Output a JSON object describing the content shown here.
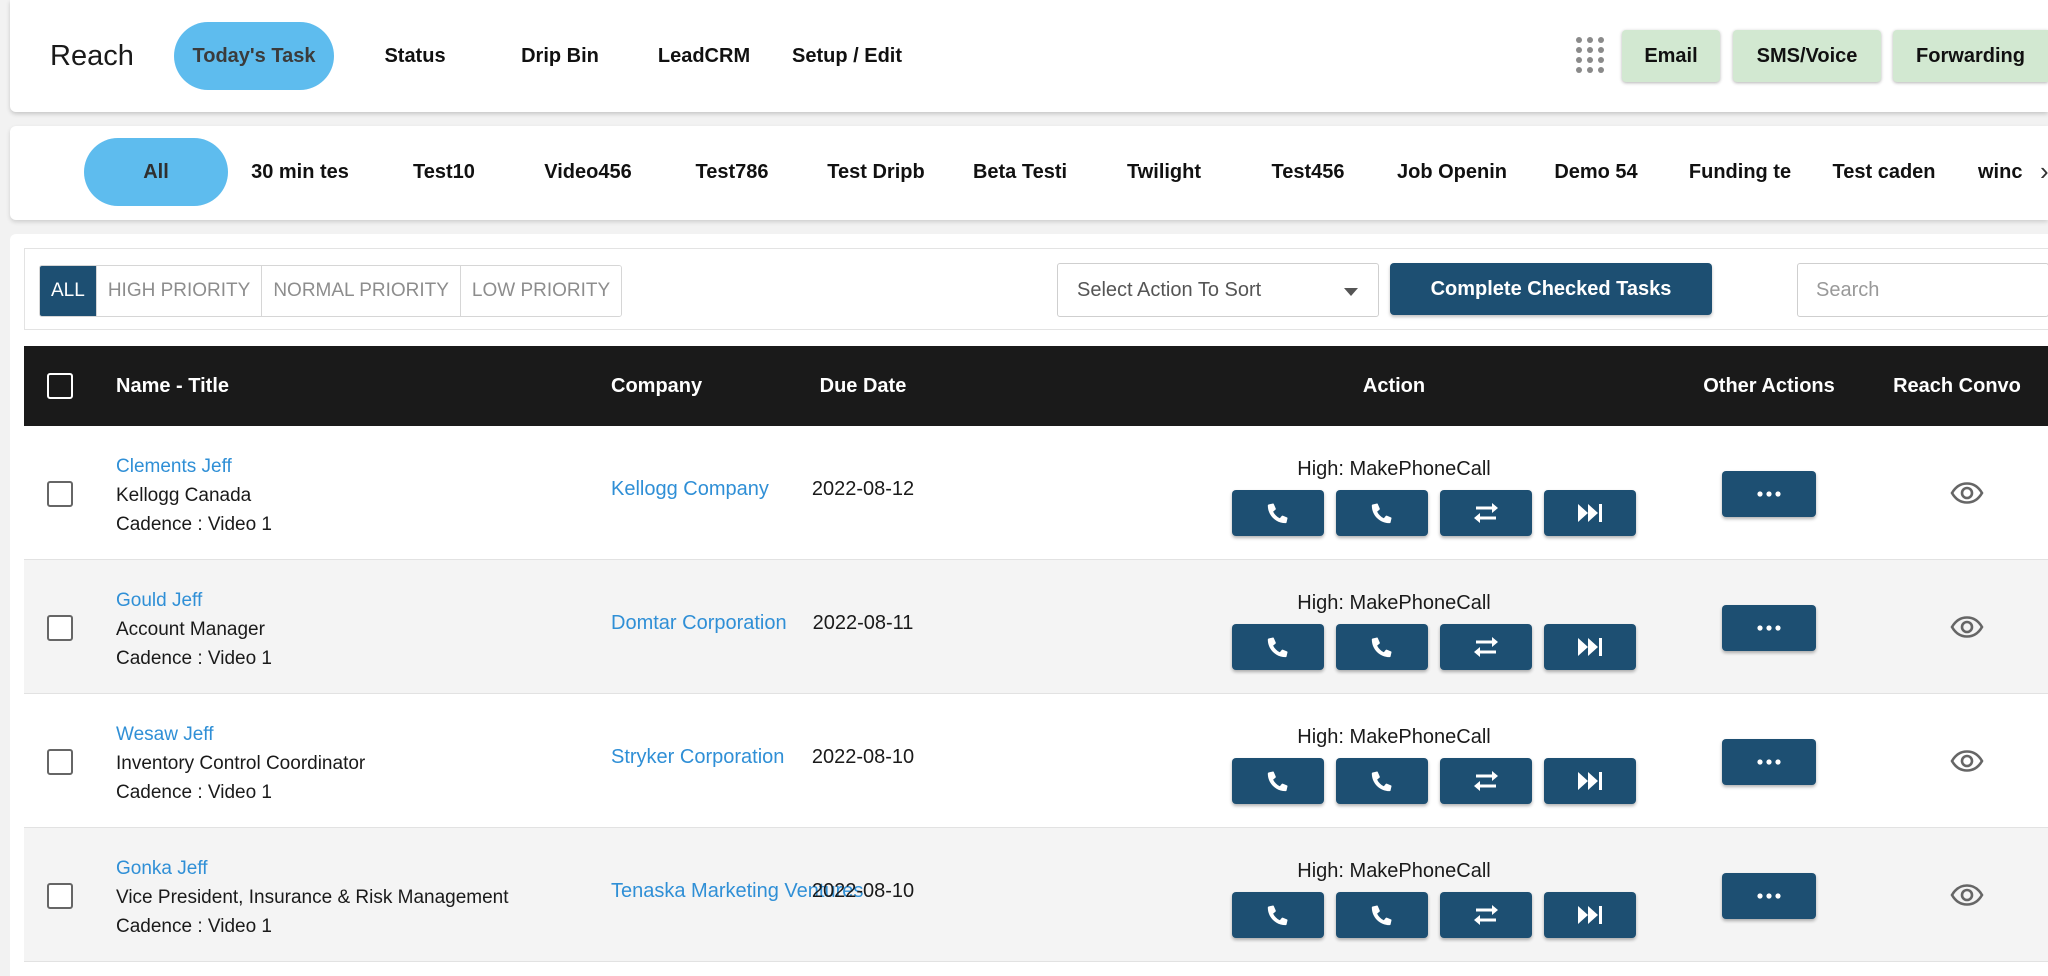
{
  "app": {
    "brand": "Reach"
  },
  "nav": {
    "items": [
      {
        "label": "Today's Task",
        "active": true
      },
      {
        "label": "Status"
      },
      {
        "label": "Drip Bin"
      },
      {
        "label": "LeadCRM"
      },
      {
        "label": "Setup / Edit"
      }
    ],
    "modes": [
      "Email",
      "SMS/Voice",
      "Forwarding"
    ]
  },
  "cadences": {
    "items": [
      "All",
      "30 min tes",
      "Test10",
      "Video456",
      "Test786",
      "Test Dripb",
      "Beta Testi",
      "Twilight",
      "Test456",
      "Job Openin",
      "Demo 54",
      "Funding te",
      "Test caden",
      "winc"
    ],
    "more_glyph": "›"
  },
  "toolbar": {
    "priorities": [
      "ALL",
      "HIGH PRIORITY",
      "NORMAL PRIORITY",
      "LOW PRIORITY"
    ],
    "sort_label": "Select Action To Sort",
    "complete_label": "Complete Checked Tasks",
    "search_placeholder": "Search"
  },
  "table": {
    "columns": {
      "name": "Name - Title",
      "company": "Company",
      "due": "Due Date",
      "action": "Action",
      "other": "Other Actions",
      "convo": "Reach Convo"
    },
    "rows": [
      {
        "name": "Clements Jeff",
        "title": "Kellogg Canada",
        "cadence": "Cadence : Video 1",
        "company": "Kellogg Company",
        "due": "2022-08-12",
        "action": "High: MakePhoneCall"
      },
      {
        "name": "Gould Jeff",
        "title": "Account Manager",
        "cadence": "Cadence : Video 1",
        "company": "Domtar Corporation",
        "due": "2022-08-11",
        "action": "High: MakePhoneCall"
      },
      {
        "name": "Wesaw Jeff",
        "title": "Inventory Control Coordinator",
        "cadence": "Cadence : Video 1",
        "company": "Stryker Corporation",
        "due": "2022-08-10",
        "action": "High: MakePhoneCall"
      },
      {
        "name": "Gonka Jeff",
        "title": "Vice President, Insurance & Risk Management",
        "cadence": "Cadence : Video 1",
        "company": "Tenaska Marketing Ventures",
        "due": "2022-08-10",
        "action": "High: MakePhoneCall"
      }
    ],
    "row_actions": [
      "phone-icon",
      "phone-icon",
      "swap-icon",
      "skip-forward-icon"
    ]
  },
  "colors": {
    "accent": "#5ebcee",
    "primary": "#1d4f72",
    "mode_button": "#d2e8d1",
    "link": "#2f8fd6",
    "table_header": "#1a1a1a"
  }
}
